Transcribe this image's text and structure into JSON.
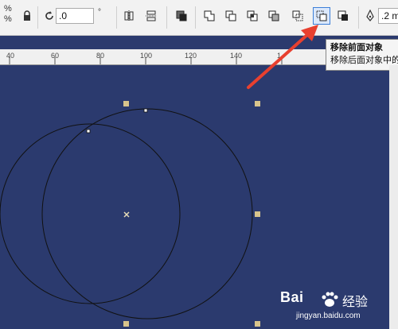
{
  "toolbar": {
    "percent_top": "%",
    "percent_bottom": "%",
    "rotation_value": ".0",
    "rotation_unit": "°",
    "outline_value": ".2 m",
    "tools": [
      {
        "name": "lock-ratio-icon"
      },
      {
        "name": "rotate-icon"
      },
      {
        "name": "mirror-horizontal-icon"
      },
      {
        "name": "mirror-vertical-icon"
      },
      {
        "name": "combine-icon"
      },
      {
        "name": "weld-icon"
      },
      {
        "name": "trim-icon"
      },
      {
        "name": "intersect-icon"
      },
      {
        "name": "simplify-icon"
      },
      {
        "name": "front-minus-back-icon"
      },
      {
        "name": "back-minus-front-icon"
      },
      {
        "name": "boundary-icon"
      },
      {
        "name": "outline-pen-icon"
      }
    ]
  },
  "ruler": {
    "labels": [
      "40",
      "60",
      "80",
      "100",
      "120",
      "140",
      "1"
    ]
  },
  "tooltip": {
    "title": "移除前面对象",
    "desc": "移除后面对象中的"
  },
  "watermark": {
    "brand": "Bai",
    "cn": "经验",
    "url": "jingyan.baidu.com"
  },
  "colors": {
    "canvas": "#2b3a6e",
    "handle": "#d8c48c",
    "arrow": "#e8402f",
    "selected": "#3c7fd8"
  }
}
